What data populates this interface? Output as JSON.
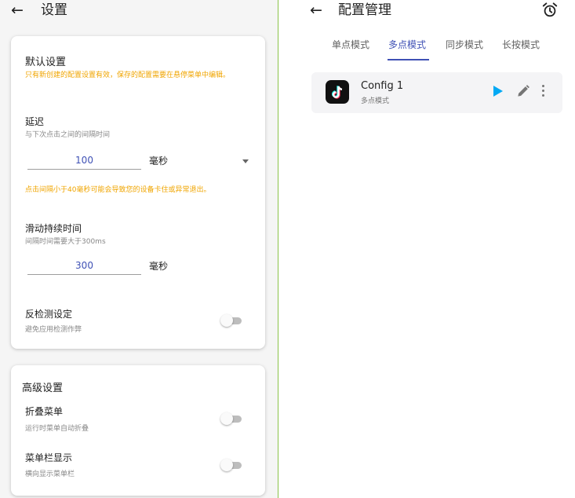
{
  "settings": {
    "title": "设置",
    "default_card": {
      "heading": "默认设置",
      "notice": "只有新创建的配置设置有效，保存的配置需要在悬停菜单中编辑。",
      "delay": {
        "label": "延迟",
        "desc": "与下次点击之间的间隔时间",
        "value": "100",
        "unit": "毫秒",
        "warning": "点击间隔小于40毫秒可能会导致您的设备卡住或异常退出。"
      },
      "swipe": {
        "label": "滑动持续时间",
        "desc": "间隔时间需要大于300ms",
        "value": "300",
        "unit": "毫秒"
      },
      "anti_detect": {
        "label": "反检测设定",
        "desc": "避免应用检测作弊",
        "enabled": false
      }
    },
    "advanced_card": {
      "heading": "高级设置",
      "fold_menu": {
        "label": "折叠菜单",
        "desc": "运行时菜单自动折叠",
        "enabled": false
      },
      "menubar": {
        "label": "菜单栏显示",
        "desc": "横向显示菜单栏",
        "enabled": false
      }
    }
  },
  "config_manager": {
    "title": "配置管理",
    "tabs": [
      "单点模式",
      "多点模式",
      "同步模式",
      "长按模式"
    ],
    "active_tab": "多点模式",
    "configs": [
      {
        "name": "Config 1",
        "mode": "多点模式",
        "icon": "tiktok-icon"
      }
    ]
  },
  "colors": {
    "accent": "#3f51b5",
    "warning": "#f0a500",
    "play": "#03a9f4",
    "divider": "#8bc34a"
  }
}
